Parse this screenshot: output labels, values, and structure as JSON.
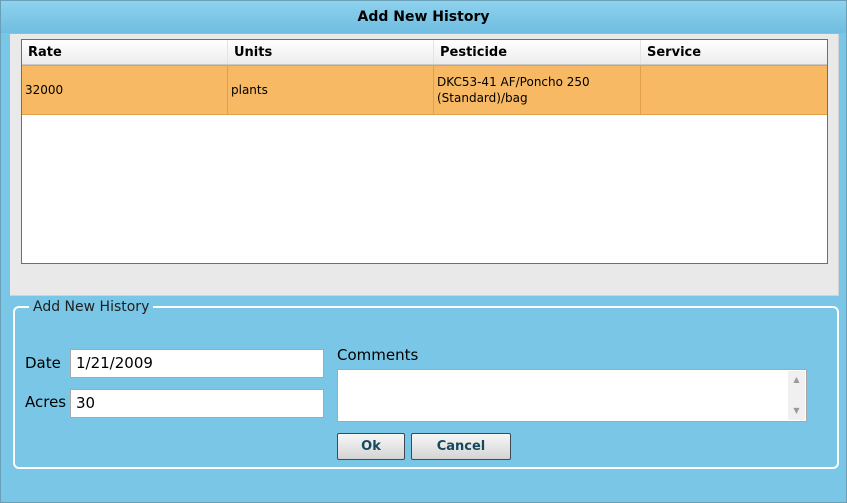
{
  "dialog": {
    "title": "Add New History"
  },
  "grid": {
    "columns": [
      "Rate",
      "Units",
      "Pesticide",
      "Service"
    ],
    "rows": [
      {
        "rate": "32000",
        "units": "plants",
        "pesticide": "DKC53-41 AF/Poncho 250 (Standard)/bag",
        "service": ""
      }
    ]
  },
  "form": {
    "legend": "Add New History",
    "date_label": "Date",
    "date_value": "1/21/2009",
    "acres_label": "Acres",
    "acres_value": "30",
    "comments_label": "Comments",
    "comments_value": "",
    "ok_label": "Ok",
    "cancel_label": "Cancel"
  },
  "colors": {
    "dialog_bg": "#79c6e6",
    "selected_row": "#f7b963"
  }
}
